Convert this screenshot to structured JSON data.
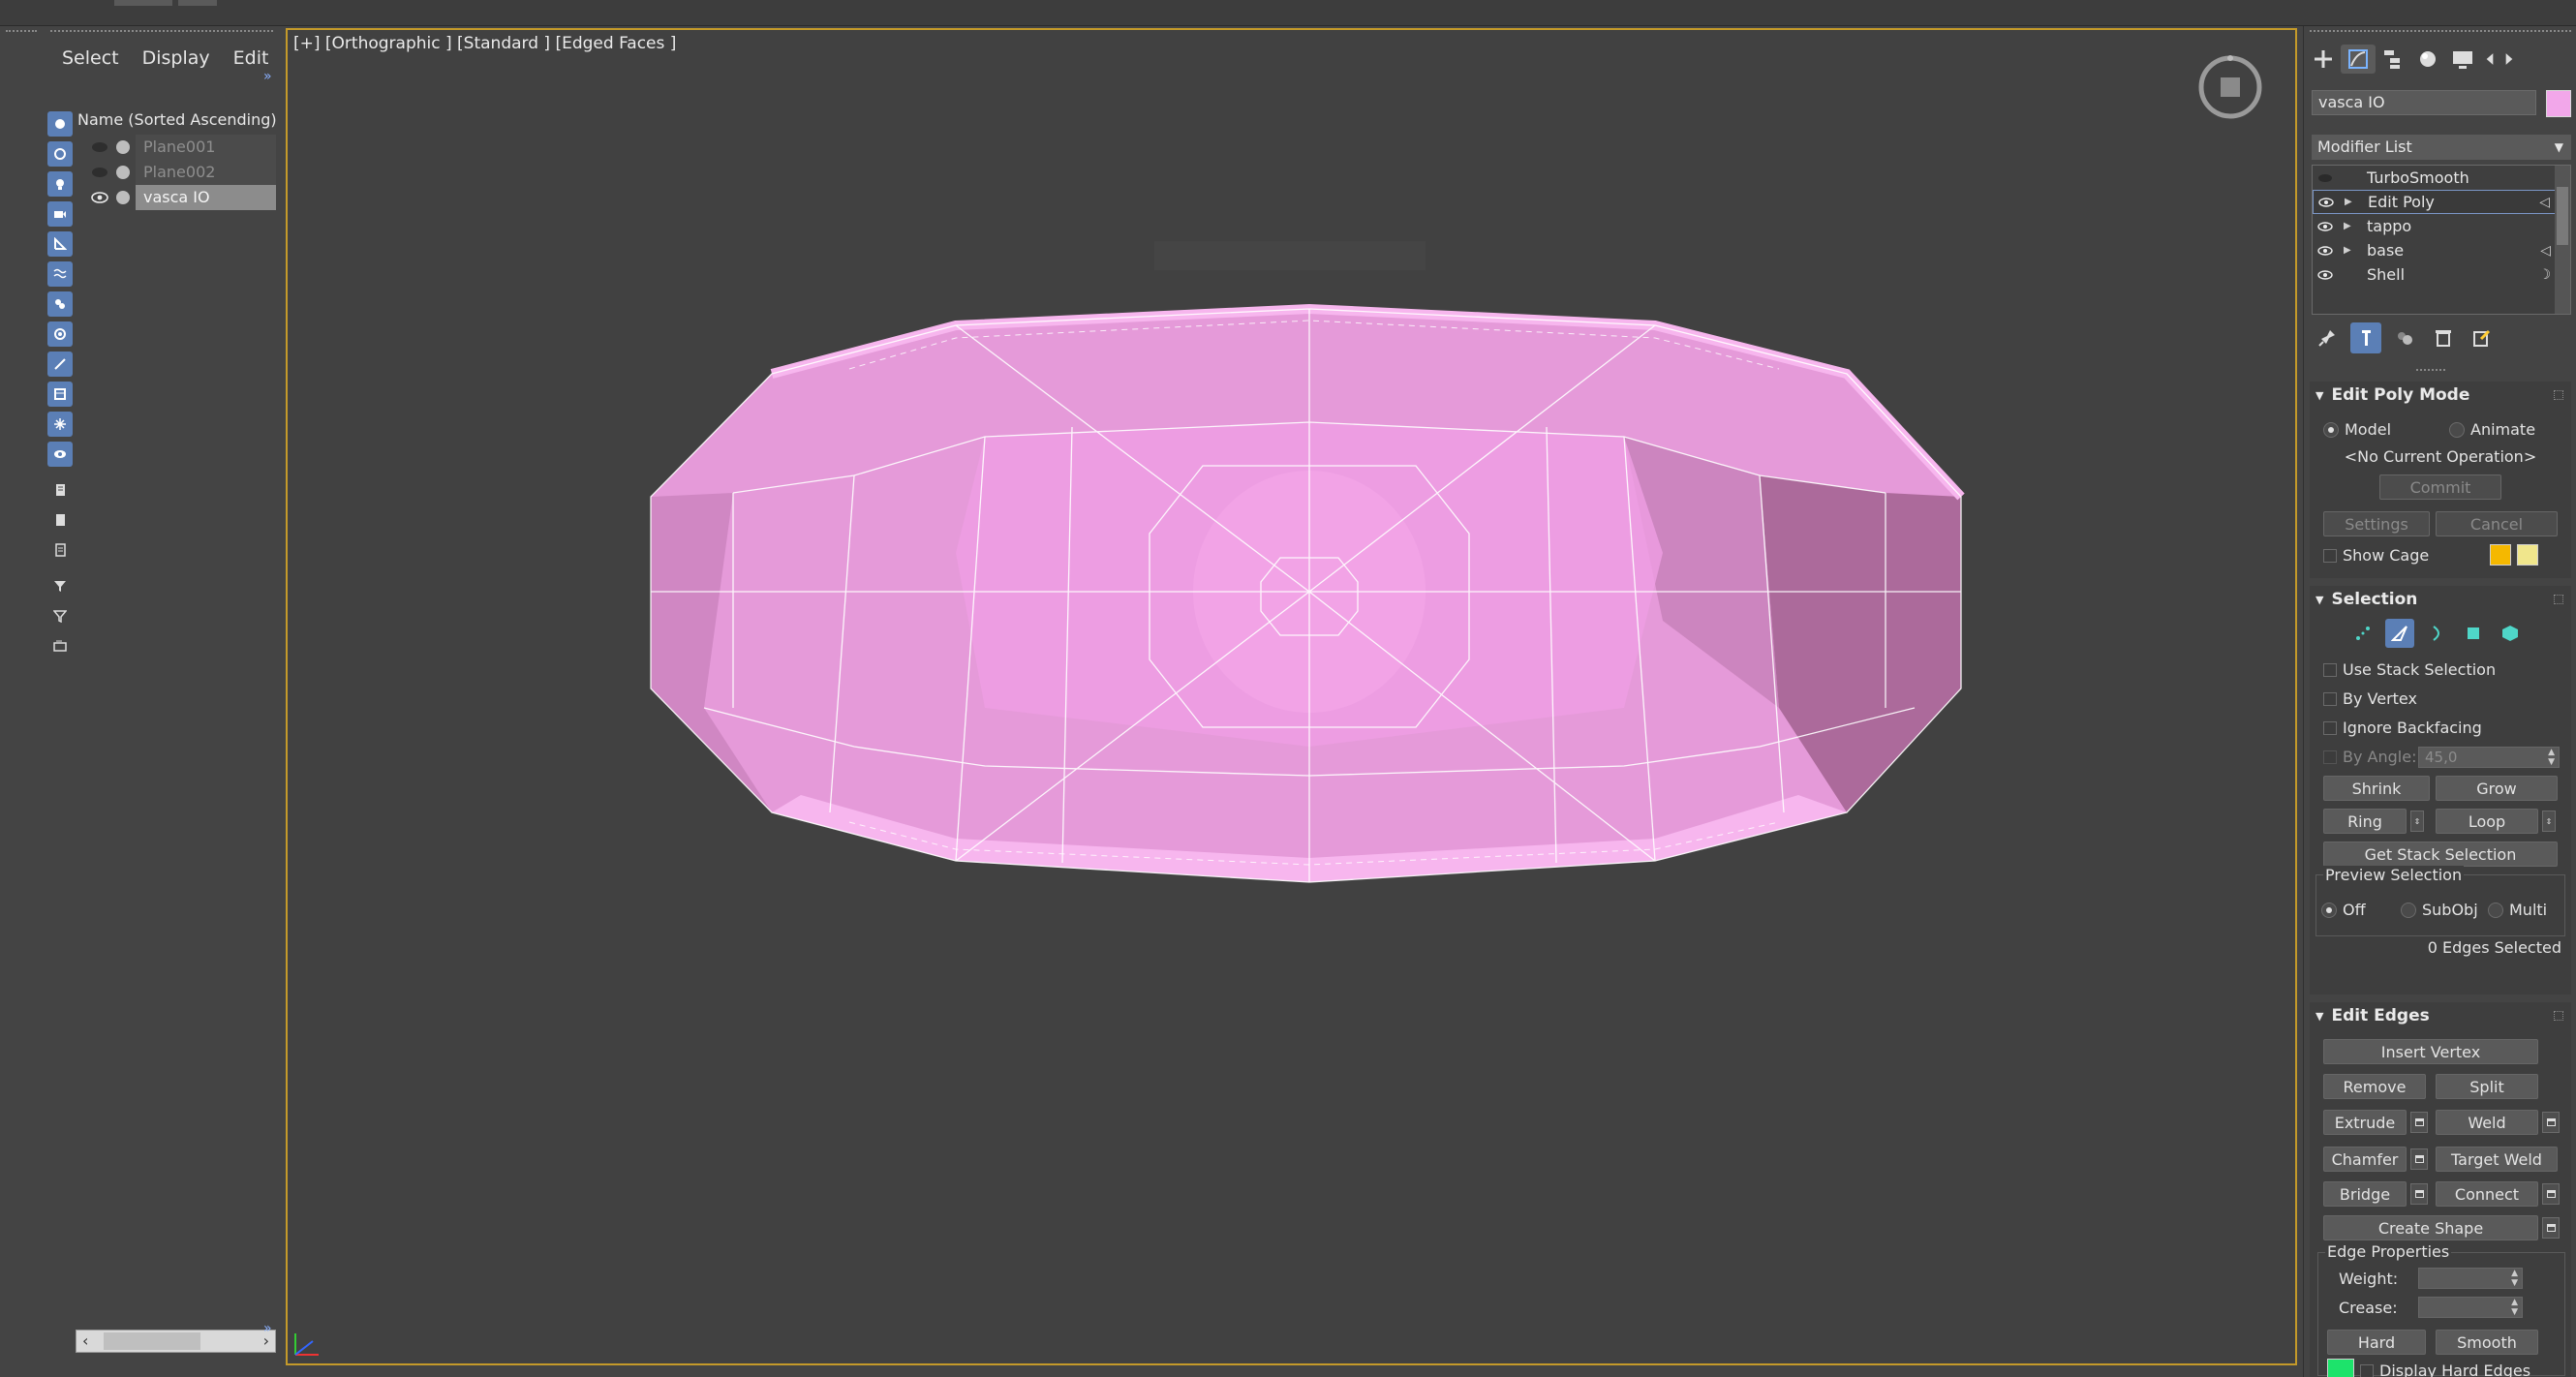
{
  "explorer": {
    "menu": [
      "Select",
      "Display",
      "Edit"
    ],
    "list_header": "Name (Sorted Ascending)",
    "objects": [
      {
        "name": "Plane001",
        "state": "hidden"
      },
      {
        "name": "Plane002",
        "state": "hidden"
      },
      {
        "name": "vasca IO",
        "state": "selected"
      }
    ]
  },
  "viewport": {
    "labels": [
      "[+]",
      "[Orthographic ]",
      "[Standard ]",
      "[Edged Faces ]"
    ],
    "mesh_color": "#f0a8e8",
    "border_color": "#c49a2a"
  },
  "command_panel": {
    "object_name": "vasca IO",
    "object_color": "#f2a7ea",
    "modifier_list_label": "Modifier List",
    "stack": [
      {
        "name": "TurboSmooth",
        "eye": false,
        "expandable": false
      },
      {
        "name": "Edit Poly",
        "eye": true,
        "expandable": true,
        "active": true
      },
      {
        "name": "tappo",
        "eye": true,
        "expandable": true
      },
      {
        "name": "base",
        "eye": true,
        "expandable": true
      },
      {
        "name": "Shell",
        "eye": true,
        "expandable": false
      }
    ],
    "edit_poly_mode": {
      "title": "Edit Poly Mode",
      "model_label": "Model",
      "animate_label": "Animate",
      "current_operation": "<No Current Operation>",
      "commit_label": "Commit",
      "settings_label": "Settings",
      "cancel_label": "Cancel",
      "show_cage_label": "Show Cage",
      "cage_colors": [
        "#f5b800",
        "#f0e68c"
      ]
    },
    "selection": {
      "title": "Selection",
      "use_stack_label": "Use Stack Selection",
      "by_vertex_label": "By Vertex",
      "ignore_backfacing_label": "Ignore Backfacing",
      "by_angle_label": "By Angle:",
      "by_angle_value": "45,0",
      "shrink_label": "Shrink",
      "grow_label": "Grow",
      "ring_label": "Ring",
      "loop_label": "Loop",
      "get_stack_label": "Get Stack Selection",
      "preview_label": "Preview Selection",
      "preview_options": [
        "Off",
        "SubObj",
        "Multi"
      ],
      "status": "0 Edges Selected"
    },
    "edit_edges": {
      "title": "Edit Edges",
      "insert_vertex": "Insert Vertex",
      "remove": "Remove",
      "split": "Split",
      "extrude": "Extrude",
      "weld": "Weld",
      "chamfer": "Chamfer",
      "target_weld": "Target Weld",
      "bridge": "Bridge",
      "connect": "Connect",
      "create_shape": "Create Shape",
      "edge_properties": "Edge Properties",
      "weight_label": "Weight:",
      "crease_label": "Crease:",
      "hard": "Hard",
      "smooth": "Smooth",
      "display_hard_edges": "Display Hard Edges",
      "hard_edge_color": "#1de36b"
    }
  }
}
